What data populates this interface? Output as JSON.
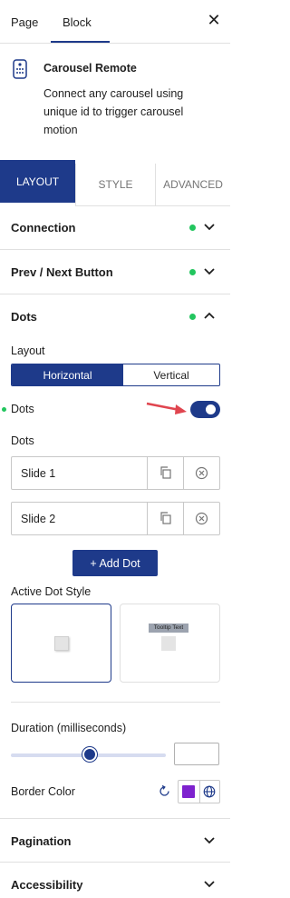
{
  "top_tabs": {
    "page": "Page",
    "block": "Block"
  },
  "block": {
    "title": "Carousel Remote",
    "description": "Connect any carousel using unique id to trigger carousel motion"
  },
  "layout_tabs": {
    "layout": "LAYOUT",
    "style": "STYLE",
    "advanced": "ADVANCED"
  },
  "panels": {
    "connection": "Connection",
    "prev_next": "Prev / Next Button",
    "dots": "Dots",
    "pagination": "Pagination",
    "accessibility": "Accessibility"
  },
  "dots_panel": {
    "layout_label": "Layout",
    "layout_options": [
      "Horizontal",
      "Vertical"
    ],
    "dots_toggle_label": "Dots",
    "dots_toggle_on": true,
    "dots_list_label": "Dots",
    "slides": [
      "Slide 1",
      "Slide 2"
    ],
    "add_dot_label": "+ Add Dot",
    "active_dot_style_label": "Active Dot Style",
    "tooltip_text": "Tooltip Text",
    "duration_label": "Duration (milliseconds)",
    "duration_value": "",
    "border_color_label": "Border Color",
    "border_color": "#7e22ce"
  },
  "colors": {
    "accent": "#1e3a8a",
    "status_dot": "#22c55e",
    "arrow": "#e0454f"
  }
}
